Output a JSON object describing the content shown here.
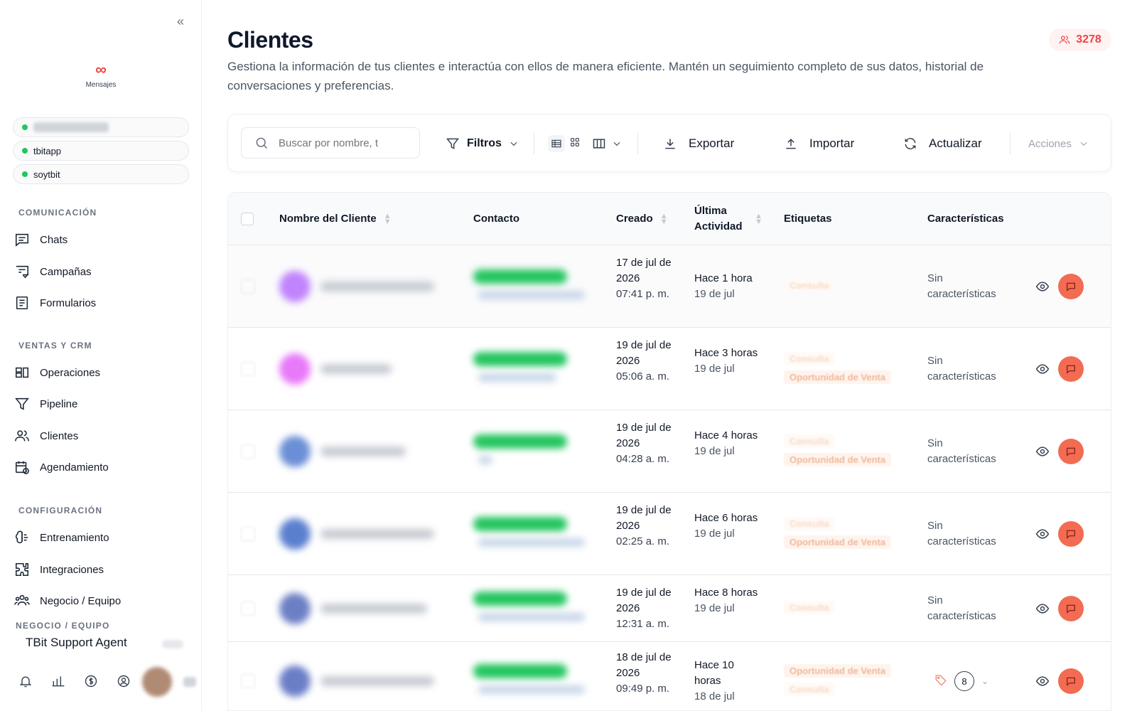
{
  "sidebar": {
    "brand_label": "Mensajes",
    "channels": [
      "",
      "tbitapp",
      "soytbit"
    ],
    "sections": [
      {
        "title": "COMUNICACIÓN",
        "items": [
          "Chats",
          "Campañas",
          "Formularios"
        ]
      },
      {
        "title": "VENTAS Y CRM",
        "items": [
          "Operaciones",
          "Pipeline",
          "Clientes",
          "Agendamiento"
        ]
      },
      {
        "title": "CONFIGURACIÓN",
        "items": [
          "Entrenamiento",
          "Integraciones",
          "Negocio / Equipo"
        ]
      }
    ],
    "footer_title": "NEGOCIO / EQUIPO",
    "agent_name": "TBit Support Agent"
  },
  "header": {
    "title": "Clientes",
    "description": "Gestiona la información de tus clientes e interactúa con ellos de manera eficiente. Mantén un seguimiento completo de sus datos, historial de conversaciones y preferencias.",
    "count": "3278"
  },
  "toolbar": {
    "search_placeholder": "Buscar por nombre, t",
    "filters": "Filtros",
    "export": "Exportar",
    "import": "Importar",
    "refresh": "Actualizar",
    "actions": "Acciones"
  },
  "table": {
    "columns": [
      "Nombre del Cliente",
      "Contacto",
      "Creado",
      "Última Actividad",
      "Etiquetas",
      "Características"
    ],
    "rows": [
      {
        "created_date": "17 de jul de 2026",
        "created_time": "07:41 p. m.",
        "activity": "Hace 1 hora",
        "activity_date": "19 de jul",
        "tags": [
          "Consulta"
        ],
        "features": "Sin características",
        "avatar_color": "#c084fc"
      },
      {
        "created_date": "19 de jul de 2026",
        "created_time": "05:06 a. m.",
        "activity": "Hace 3 horas",
        "activity_date": "19 de jul",
        "tags": [
          "Consulta",
          "Oportunidad de Venta"
        ],
        "features": "Sin características",
        "avatar_color": "#e879f9"
      },
      {
        "created_date": "19 de jul de 2026",
        "created_time": "04:28 a. m.",
        "activity": "Hace 4 horas",
        "activity_date": "19 de jul",
        "tags": [
          "Consulta",
          "Oportunidad de Venta"
        ],
        "features": "Sin características",
        "avatar_color": "#6b8fd6"
      },
      {
        "created_date": "19 de jul de 2026",
        "created_time": "02:25 a. m.",
        "activity": "Hace 6 horas",
        "activity_date": "19 de jul",
        "tags": [
          "Consulta",
          "Oportunidad de Venta"
        ],
        "features": "Sin características",
        "avatar_color": "#5b7fcf"
      },
      {
        "created_date": "19 de jul de 2026",
        "created_time": "12:31 a. m.",
        "activity": "Hace 8 horas",
        "activity_date": "19 de jul",
        "tags": [
          "Consulta"
        ],
        "features": "Sin características",
        "avatar_color": "#6d7fc4"
      },
      {
        "created_date": "18 de jul de 2026",
        "created_time": "09:49 p. m.",
        "activity": "Hace 10 horas",
        "activity_date": "18 de jul",
        "tags": [
          "Oportunidad de Venta",
          "Consulta"
        ],
        "features": "",
        "feature_count": "8",
        "avatar_color": "#6a7ec8"
      }
    ]
  },
  "colors": {
    "accent": "#ef4444",
    "chat_button": "#f26b52",
    "online": "#22c55e"
  }
}
